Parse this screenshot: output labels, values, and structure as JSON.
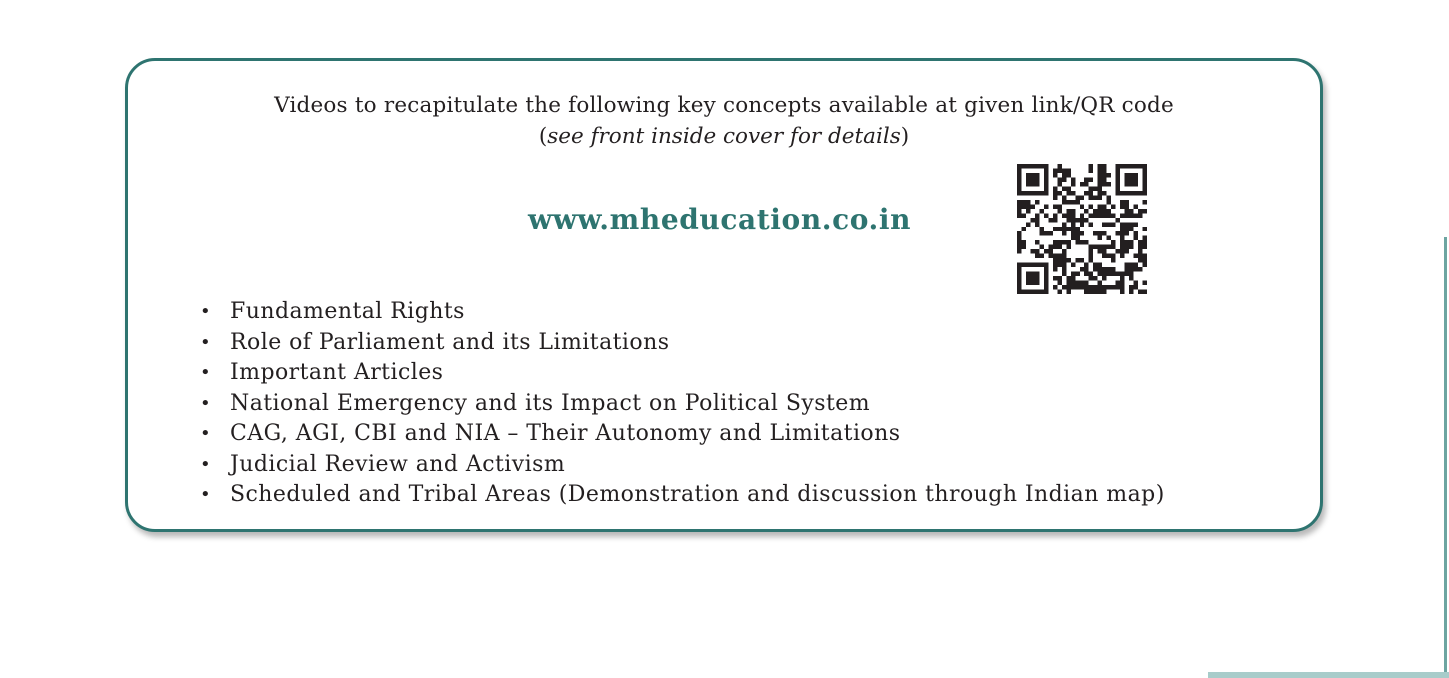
{
  "box": {
    "intro_line1": "Videos to recapitulate the following key concepts available at given link/QR code",
    "intro_line2_open": "(",
    "intro_line2_italic": "see front inside cover for details",
    "intro_line2_close": ")",
    "url": "www.mheducation.co.in",
    "topics": [
      "Fundamental Rights",
      "Role of Parliament and its Limitations",
      "Important Articles",
      "National Emergency and its Impact on Political System",
      "CAG, AGI, CBI and NIA – Their Autonomy and Limitations",
      "Judicial Review and Activism",
      "Scheduled and Tribal Areas (Demonstration and discussion through Indian map)"
    ],
    "bullet": "•"
  },
  "colors": {
    "accent": "#2e7470",
    "text": "#231f20"
  },
  "icons": {
    "qr": "qr-code-icon"
  }
}
